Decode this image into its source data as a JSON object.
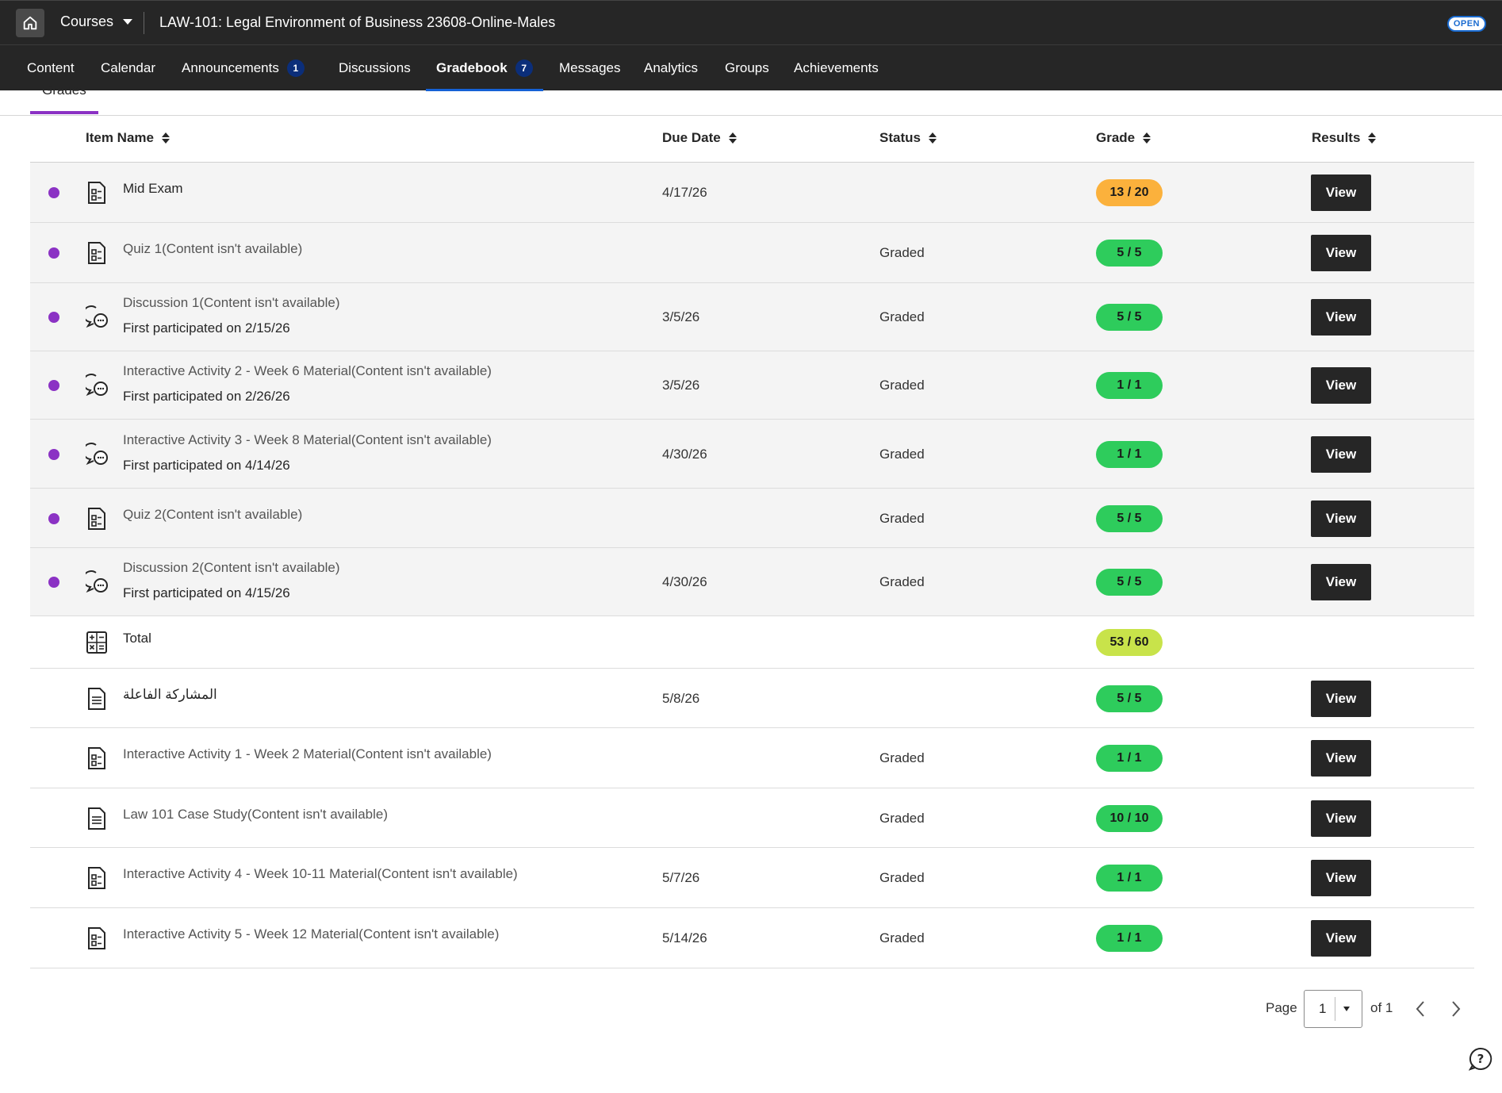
{
  "header": {
    "courses_label": "Courses",
    "course_title": "LAW-101: Legal Environment of Business 23608-Online-Males",
    "open_badge": "OPEN"
  },
  "nav": {
    "content": "Content",
    "calendar": "Calendar",
    "announcements": "Announcements",
    "announcements_count": "1",
    "discussions": "Discussions",
    "gradebook": "Gradebook",
    "gradebook_count": "7",
    "messages": "Messages",
    "analytics": "Analytics",
    "groups": "Groups",
    "achievements": "Achievements"
  },
  "subtab": {
    "grades": "Grades"
  },
  "table": {
    "headers": {
      "item_name": "Item Name",
      "due_date": "Due Date",
      "status": "Status",
      "grade": "Grade",
      "results": "Results"
    },
    "view_label": "View",
    "rows": [
      {
        "name": "Mid Exam",
        "sub": "",
        "due": "4/17/26",
        "status": "",
        "grade": "13 / 20",
        "grade_color": "#fbb13c",
        "icon": "test-icon",
        "new": true
      },
      {
        "name": "Quiz 1(Content isn't available)",
        "sub": "",
        "due": "",
        "status": "Graded",
        "grade": "5 / 5",
        "grade_color": "#2ecc5c",
        "icon": "test-icon",
        "new": true
      },
      {
        "name": "Discussion 1(Content isn't available)",
        "sub": "First participated on 2/15/26",
        "due": "3/5/26",
        "status": "Graded",
        "grade": "5 / 5",
        "grade_color": "#2ecc5c",
        "icon": "discussion-icon",
        "new": true
      },
      {
        "name": "Interactive Activity 2 - Week 6 Material(Content isn't available)",
        "sub": "First participated on 2/26/26",
        "due": "3/5/26",
        "status": "Graded",
        "grade": "1 / 1",
        "grade_color": "#2ecc5c",
        "icon": "discussion-icon",
        "new": true
      },
      {
        "name": "Interactive Activity 3 - Week 8 Material(Content isn't available)",
        "sub": "First participated on 4/14/26",
        "due": "4/30/26",
        "status": "Graded",
        "grade": "1 / 1",
        "grade_color": "#2ecc5c",
        "icon": "discussion-icon",
        "new": true
      },
      {
        "name": "Quiz 2(Content isn't available)",
        "sub": "",
        "due": "",
        "status": "Graded",
        "grade": "5 / 5",
        "grade_color": "#2ecc5c",
        "icon": "test-icon",
        "new": true
      },
      {
        "name": "Discussion 2(Content isn't available)",
        "sub": "First participated on 4/15/26",
        "due": "4/30/26",
        "status": "Graded",
        "grade": "5 / 5",
        "grade_color": "#2ecc5c",
        "icon": "discussion-icon",
        "new": true
      },
      {
        "name": "Total",
        "sub": "",
        "due": "",
        "status": "",
        "grade": "53 / 60",
        "grade_color": "#c8e34a",
        "icon": "calculator-icon",
        "new": false
      },
      {
        "name": "المشاركة الفاعلة",
        "sub": "",
        "due": "5/8/26",
        "status": "",
        "grade": "5 / 5",
        "grade_color": "#2ecc5c",
        "icon": "document-icon",
        "new": false
      },
      {
        "name": "Interactive Activity 1 - Week 2 Material(Content isn't available)",
        "sub": "",
        "due": "",
        "status": "Graded",
        "grade": "1 / 1",
        "grade_color": "#2ecc5c",
        "icon": "test-icon",
        "new": false
      },
      {
        "name": "Law 101 Case Study(Content isn't available)",
        "sub": "",
        "due": "",
        "status": "Graded",
        "grade": "10 / 10",
        "grade_color": "#2ecc5c",
        "icon": "document-icon",
        "new": false
      },
      {
        "name": "Interactive Activity 4 - Week 10-11 Material(Content isn't available)",
        "sub": "",
        "due": "5/7/26",
        "status": "Graded",
        "grade": "1 / 1",
        "grade_color": "#2ecc5c",
        "icon": "test-icon",
        "new": false
      },
      {
        "name": "Interactive Activity 5 - Week 12 Material(Content isn't available)",
        "sub": "",
        "due": "5/14/26",
        "status": "Graded",
        "grade": "1 / 1",
        "grade_color": "#2ecc5c",
        "icon": "test-icon",
        "new": false
      }
    ]
  },
  "pagination": {
    "page_label": "Page",
    "current": "1",
    "of_label": "of 1"
  },
  "colors": {
    "accent_purple": "#8b32c4",
    "nav_active_blue": "#1561d6",
    "dark_bg": "#262626"
  }
}
